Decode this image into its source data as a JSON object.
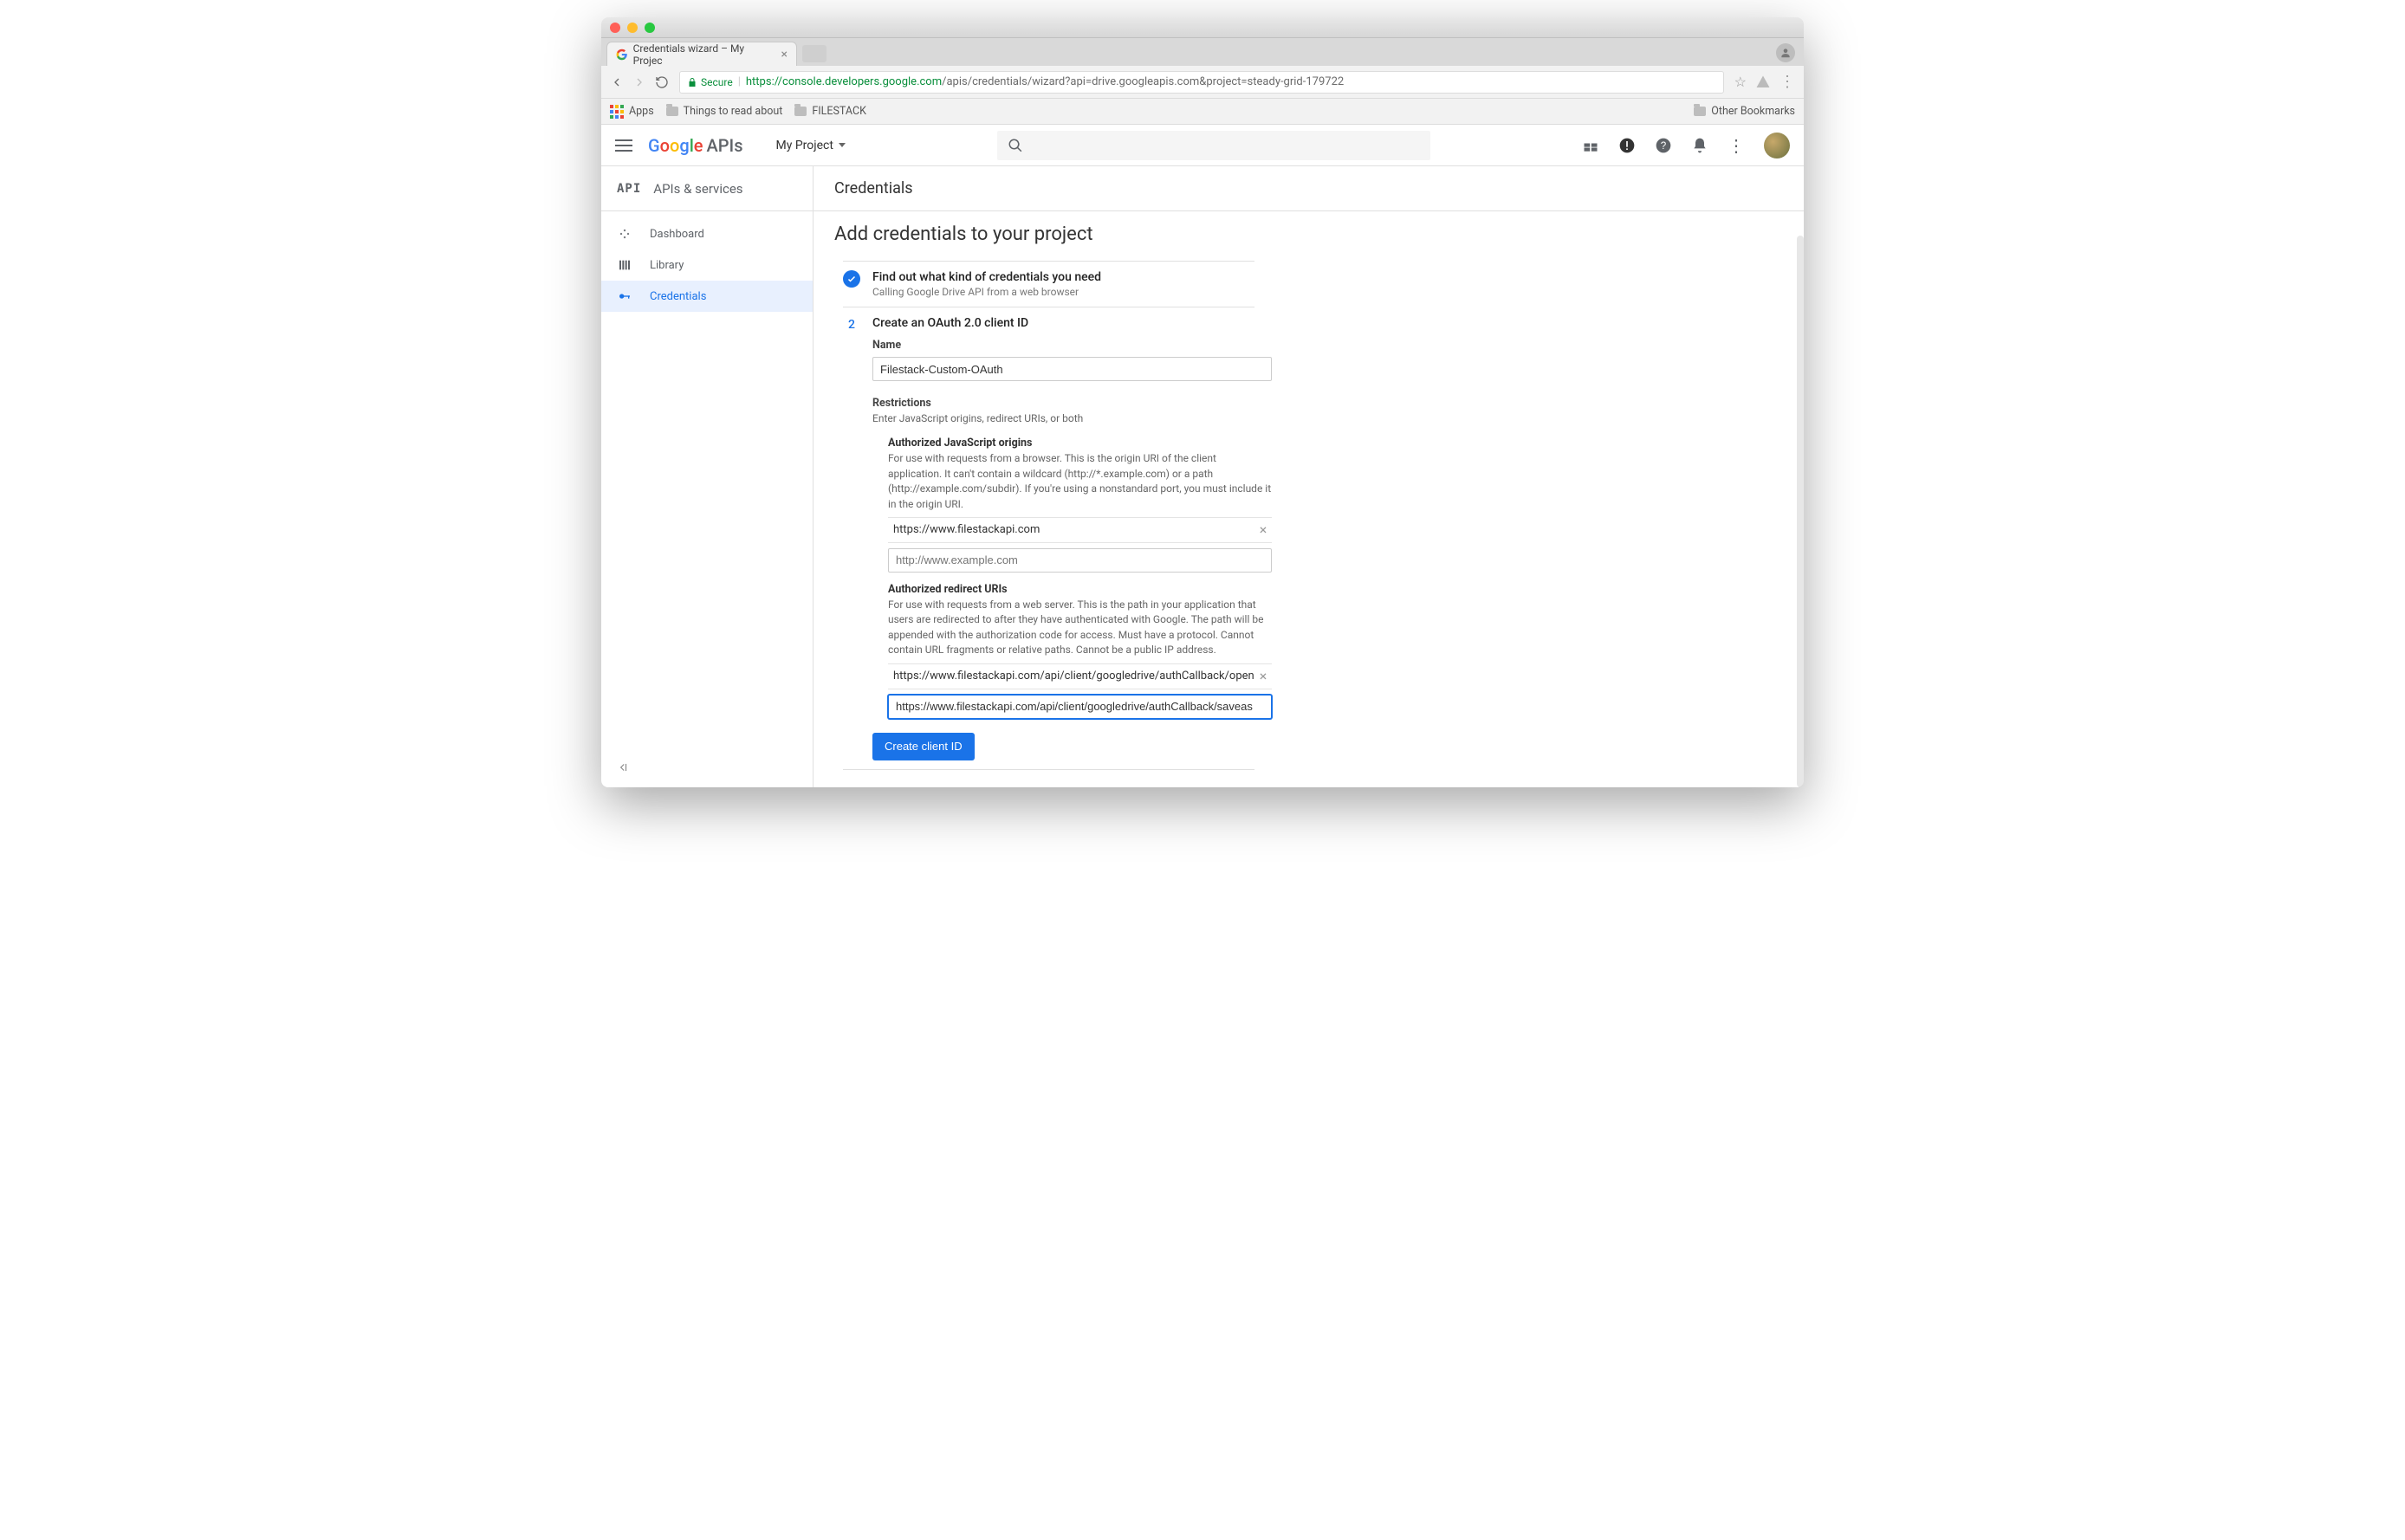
{
  "browser": {
    "tab_title": "Credentials wizard – My Projec",
    "secure_label": "Secure",
    "url_host": "https://console.developers.google.com",
    "url_path": "/apis/credentials/wizard?api=drive.googleapis.com&project=steady-grid-179722",
    "bookmarks": {
      "apps": "Apps",
      "read": "Things to read about",
      "filestack": "FILESTACK",
      "other": "Other Bookmarks"
    }
  },
  "header": {
    "logo_apis": "APIs",
    "project": "My Project"
  },
  "sidebar": {
    "title": "APIs & services",
    "items": [
      {
        "label": "Dashboard"
      },
      {
        "label": "Library"
      },
      {
        "label": "Credentials"
      }
    ]
  },
  "page": {
    "title": "Credentials",
    "heading": "Add credentials to your project",
    "step1_title": "Find out what kind of credentials you need",
    "step1_sub": "Calling Google Drive API from a web browser",
    "step2_num": "2",
    "step2_title": "Create an OAuth 2.0 client ID",
    "name_label": "Name",
    "name_value": "Filestack-Custom-OAuth",
    "restrictions_label": "Restrictions",
    "restrictions_help": "Enter JavaScript origins, redirect URIs, or both",
    "origins_title": "Authorized JavaScript origins",
    "origins_help": "For use with requests from a browser. This is the origin URI of the client application. It can't contain a wildcard (http://*.example.com) or a path (http://example.com/subdir). If you're using a nonstandard port, you must include it in the origin URI.",
    "origins_entry": "https://www.filestackapi.com",
    "origins_placeholder": "http://www.example.com",
    "redirect_title": "Authorized redirect URIs",
    "redirect_help": "For use with requests from a web server. This is the path in your application that users are redirected to after they have authenticated with Google. The path will be appended with the authorization code for access. Must have a protocol. Cannot contain URL fragments or relative paths. Cannot be a public IP address.",
    "redirect_entry": "https://www.filestackapi.com/api/client/googledrive/authCallback/open",
    "redirect_typing": "https://www.filestackapi.com/api/client/googledrive/authCallback/saveas",
    "create_button": "Create client ID"
  }
}
